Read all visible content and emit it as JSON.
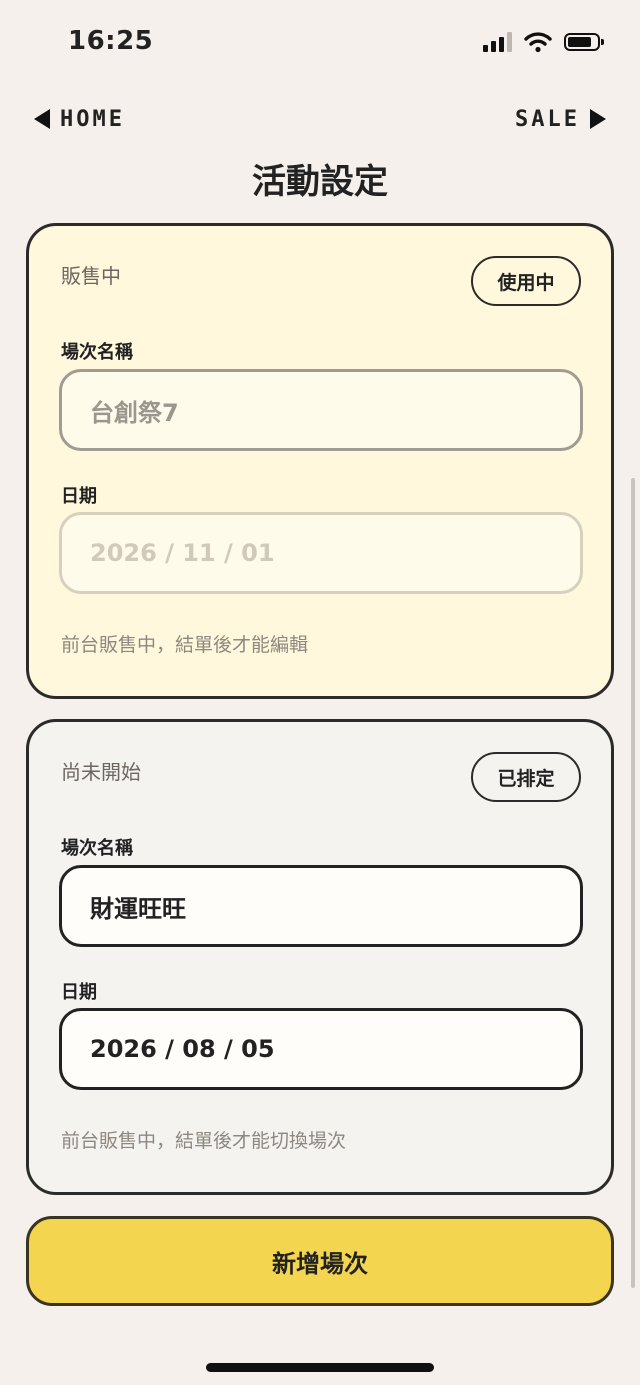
{
  "status_bar": {
    "time": "16:25",
    "signal_icon": "cellular-signal-icon",
    "wifi_icon": "wifi-icon",
    "battery_icon": "battery-icon"
  },
  "nav": {
    "home_label": "HOME",
    "sale_label": "SALE"
  },
  "page_title": "活動設定",
  "active_event": {
    "status": "販售中",
    "badge": "使用中",
    "name_label": "場次名稱",
    "name_value": "台創祭7",
    "date_label": "日期",
    "date_value": "2026 / 11 / 01",
    "hint": "前台販售中，結單後才能編輯"
  },
  "pending_event": {
    "status": "尚未開始",
    "badge": "已排定",
    "name_label": "場次名稱",
    "name_value": "財運旺旺",
    "date_label": "日期",
    "date_value": "2026 / 08 / 05",
    "hint": "前台販售中，結單後才能切換場次"
  },
  "add_button_label": "新增場次",
  "colors": {
    "background": "#f5f0eb",
    "active_card": "#fff8dc",
    "pending_card": "#f4f3f0",
    "accent": "#f3d54f",
    "border": "#2b2b2b"
  }
}
